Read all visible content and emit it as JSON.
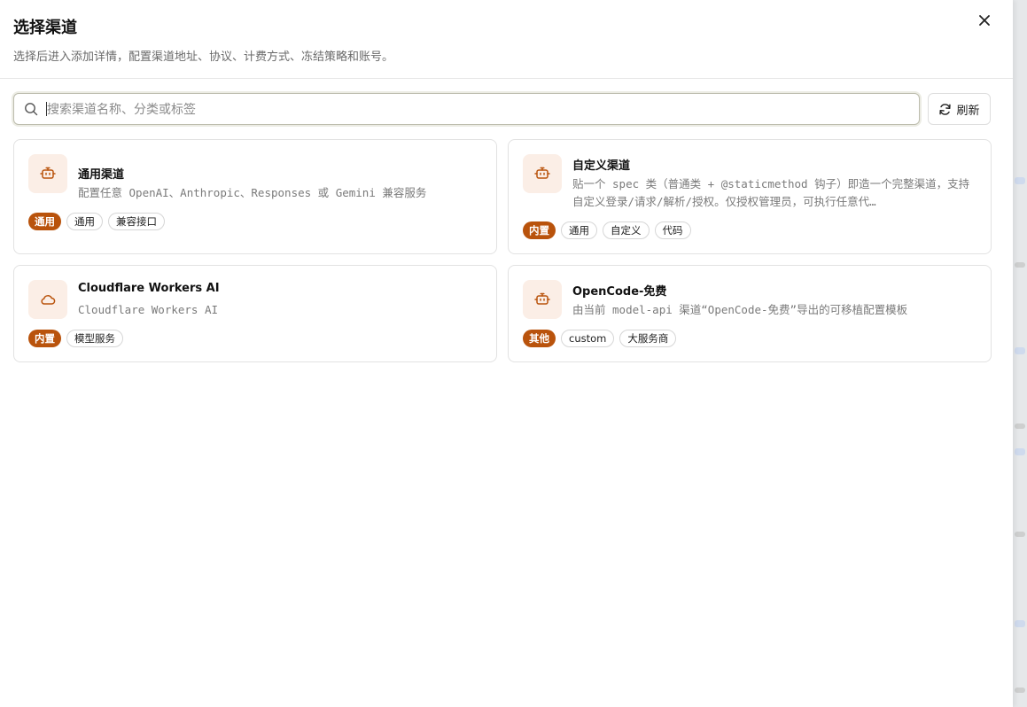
{
  "dialog": {
    "title": "选择渠道",
    "subtitle": "选择后进入添加详情，配置渠道地址、协议、计费方式、冻结策略和账号。",
    "close_icon": "close-icon"
  },
  "search": {
    "placeholder": "搜索渠道名称、分类或标签",
    "value": "",
    "icon": "search-icon"
  },
  "refresh": {
    "label": "刷新",
    "icon": "refresh-icon"
  },
  "colors": {
    "accent": "#b9530c",
    "icon_bg": "#fbeee6",
    "icon_stroke": "#b9530c"
  },
  "cards": [
    {
      "name": "通用渠道",
      "desc": "配置任意 OpenAI、Anthropic、Responses 或 Gemini 兼容服务",
      "icon": "bot-icon",
      "badge": "通用",
      "tags": [
        "通用",
        "兼容接口"
      ]
    },
    {
      "name": "自定义渠道",
      "desc": "贴一个 spec 类（普通类 + @staticmethod 钩子）即造一个完整渠道，支持自定义登录/请求/解析/授权。仅授权管理员，可执行任意代…",
      "icon": "bot-icon",
      "badge": "内置",
      "tags": [
        "通用",
        "自定义",
        "代码"
      ]
    },
    {
      "name": "Cloudflare Workers AI",
      "desc": "Cloudflare Workers AI",
      "icon": "cloud-icon",
      "badge": "内置",
      "tags": [
        "模型服务"
      ]
    },
    {
      "name": "OpenCode-免费",
      "desc": "由当前 model-api 渠道“OpenCode-免费”导出的可移植配置模板",
      "icon": "bot-icon",
      "badge": "其他",
      "tags": [
        "custom",
        "大服务商"
      ]
    }
  ]
}
